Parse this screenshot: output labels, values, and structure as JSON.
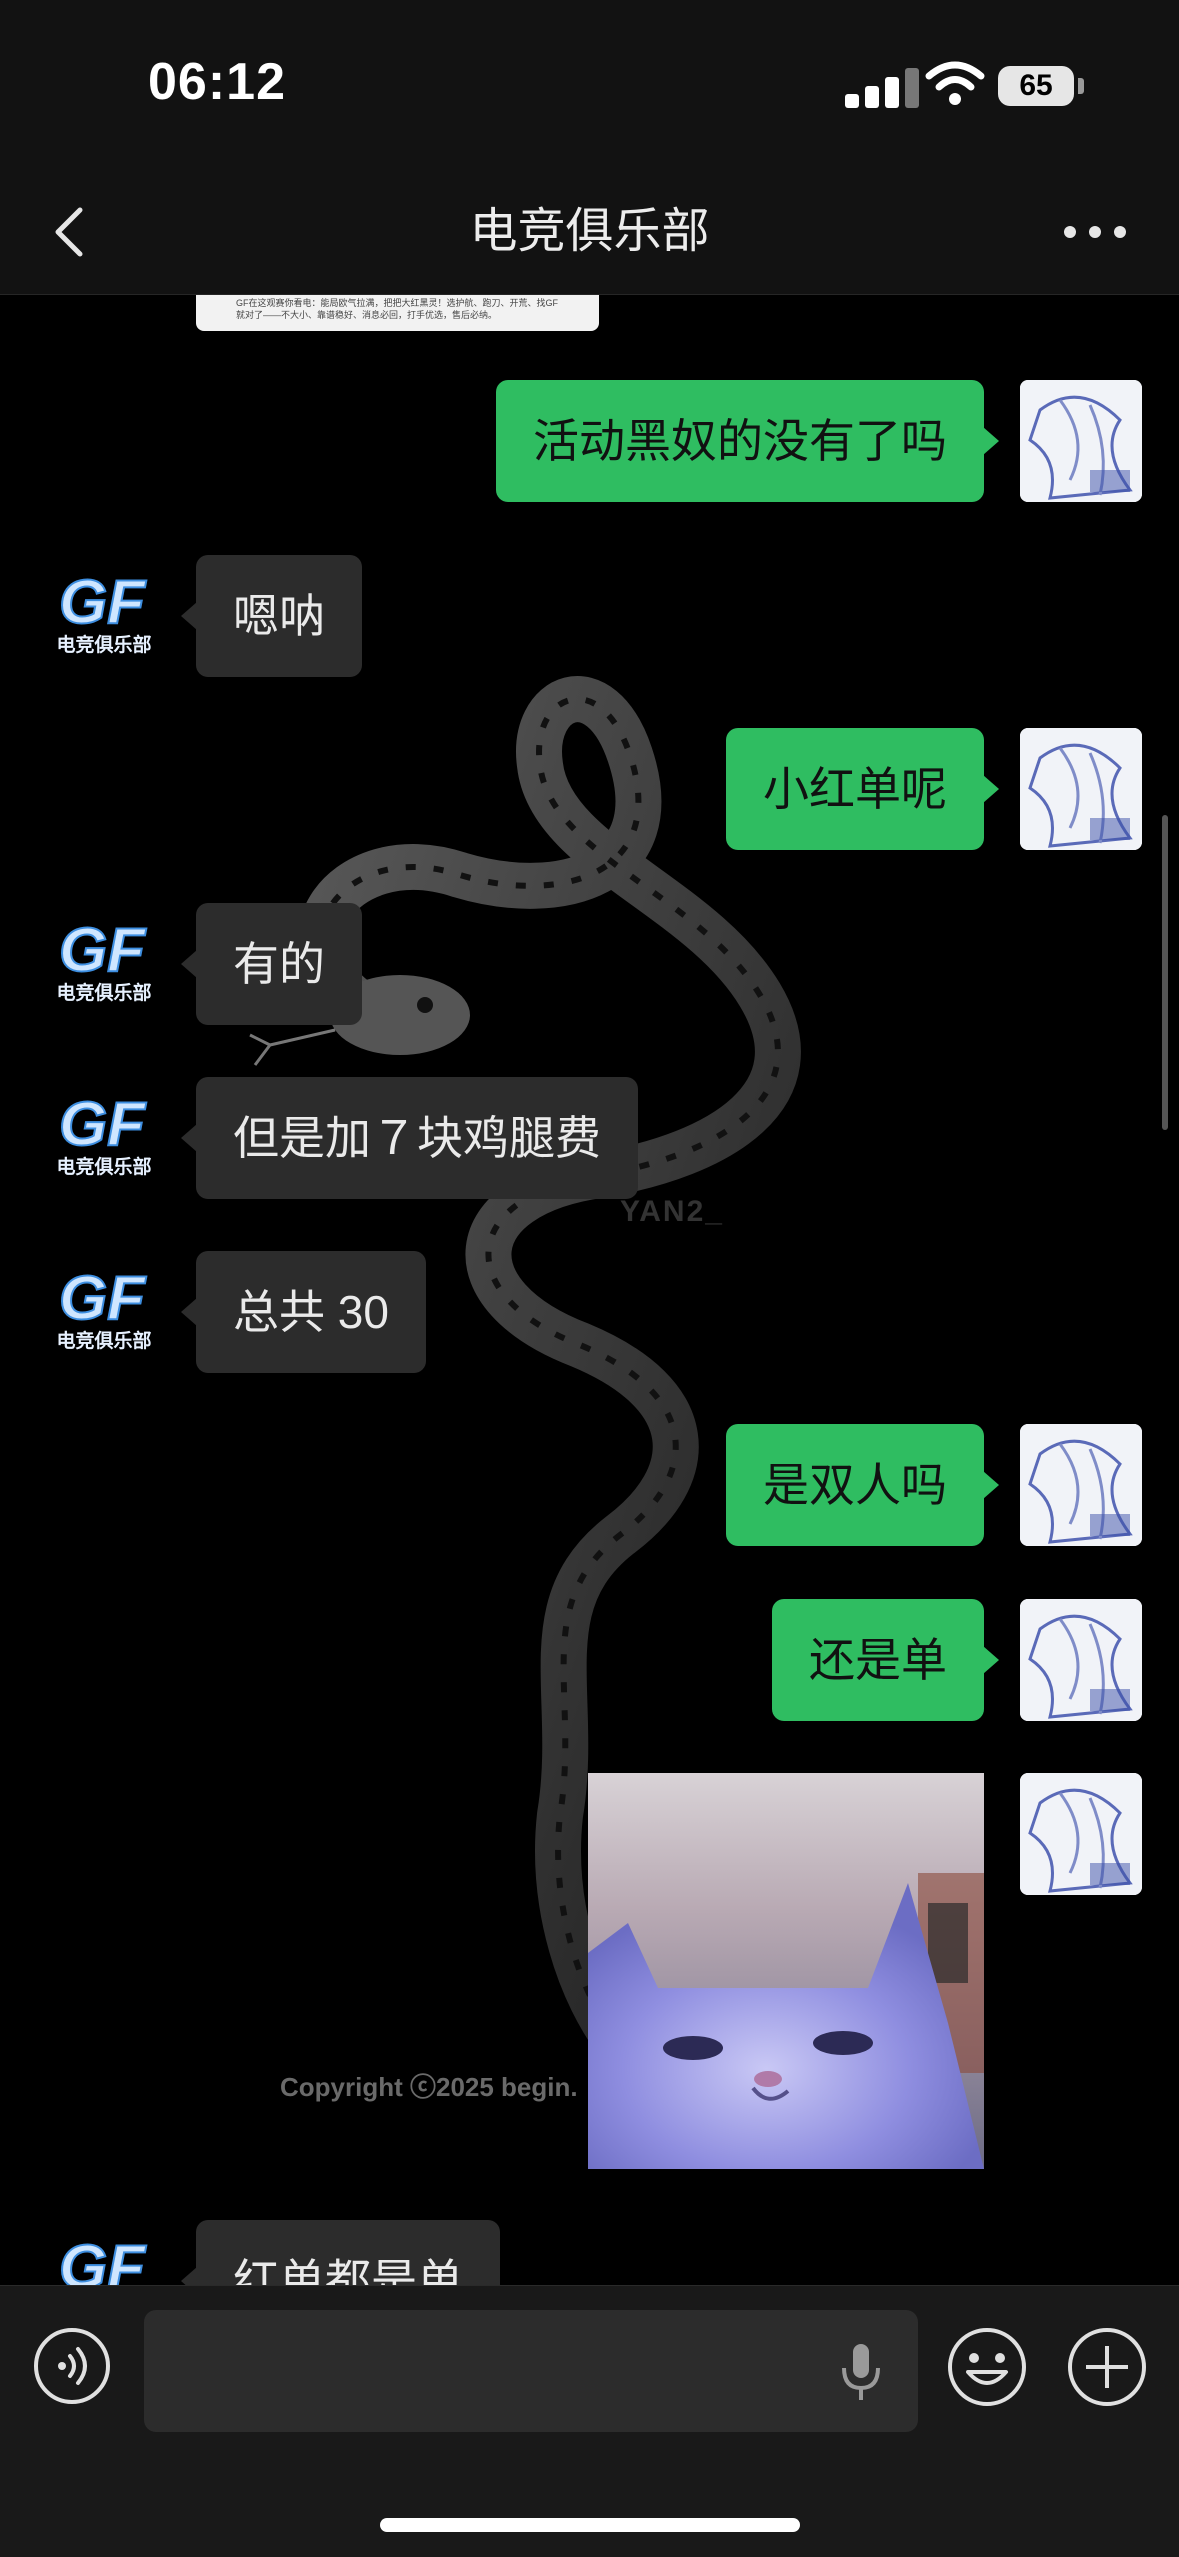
{
  "status_bar": {
    "time": "06:12",
    "battery": "65"
  },
  "header": {
    "title": "电竞俱乐部"
  },
  "doc_card": {
    "text": "GF在这观赛你看电：能局欧气拉满，把把大红黑灵！选护航、跑刀、开荒、找GF就对了——不大小、靠谱稳好、消息必回，打手优选，售后必纳。"
  },
  "background": {
    "watermark": "Copyright ⓒ2025 begin.",
    "tag": "YAN2_"
  },
  "messages": [
    {
      "side": "out",
      "text": "活动黑奴的没有了吗"
    },
    {
      "side": "in",
      "text": "嗯呐"
    },
    {
      "side": "out",
      "text": "小红单呢"
    },
    {
      "side": "in",
      "text": "有的"
    },
    {
      "side": "in",
      "text": "但是加７块鸡腿费"
    },
    {
      "side": "in",
      "text": "总共 30"
    },
    {
      "side": "out",
      "text": "是双人吗"
    },
    {
      "side": "out",
      "text": "还是单"
    },
    {
      "side": "in",
      "text": "红单都是单"
    }
  ],
  "club_avatar_text": "GF",
  "club_avatar_subtext": "电竞俱乐部",
  "icons": {
    "back": "chevron-left-icon",
    "more": "more-dots-icon",
    "voice": "voice-icon",
    "mic": "microphone-icon",
    "emoji": "emoji-icon",
    "plus": "plus-icon"
  },
  "colors": {
    "outgoing_bubble": "#2fbd61",
    "incoming_bubble": "#2c2c2c",
    "background": "#000000"
  }
}
